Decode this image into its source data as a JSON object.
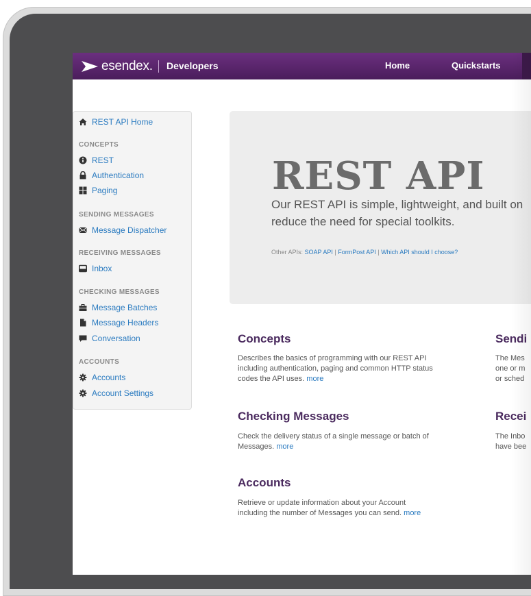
{
  "header": {
    "brand": "esendex",
    "brand_dot": ".",
    "section": "Developers",
    "nav": [
      {
        "label": "Home"
      },
      {
        "label": "Quickstarts"
      }
    ]
  },
  "sidebar": {
    "home": {
      "label": "REST API Home",
      "icon": "home-icon"
    },
    "groups": [
      {
        "heading": "CONCEPTS",
        "items": [
          {
            "label": "REST",
            "icon": "info-icon"
          },
          {
            "label": "Authentication",
            "icon": "lock-icon"
          },
          {
            "label": "Paging",
            "icon": "grid-icon"
          }
        ]
      },
      {
        "heading": "SENDING MESSAGES",
        "items": [
          {
            "label": "Message Dispatcher",
            "icon": "envelope-icon"
          }
        ]
      },
      {
        "heading": "RECEIVING MESSAGES",
        "items": [
          {
            "label": "Inbox",
            "icon": "inbox-icon"
          }
        ]
      },
      {
        "heading": "CHECKING MESSAGES",
        "items": [
          {
            "label": "Message Batches",
            "icon": "briefcase-icon"
          },
          {
            "label": "Message Headers",
            "icon": "file-icon"
          },
          {
            "label": "Conversation",
            "icon": "comment-icon"
          }
        ]
      },
      {
        "heading": "ACCOUNTS",
        "items": [
          {
            "label": "Accounts",
            "icon": "gear-icon"
          },
          {
            "label": "Account Settings",
            "icon": "gear-icon"
          }
        ]
      }
    ]
  },
  "hero": {
    "title": "REST API",
    "description_line1": "Our REST API is simple, lightweight, and built on",
    "description_line2": "reduce the need for special toolkits.",
    "other_label": "Other APIs:",
    "links": [
      "SOAP API",
      "FormPost API",
      "Which API should I choose?"
    ],
    "separator": "|"
  },
  "sections": {
    "concepts": {
      "title": "Concepts",
      "line1": "Describes the basics of programming with our REST API",
      "line2": "including authentication, paging and common HTTP status",
      "line3": "codes the API uses.",
      "more": "more"
    },
    "sending": {
      "title": "Sendi",
      "line1": "The Mes",
      "line2": "one or m",
      "line3": "or sched"
    },
    "checking": {
      "title": "Checking Messages",
      "line1": "Check the delivery status of a single message or batch of",
      "line2": "Messages.",
      "more": "more"
    },
    "receiving": {
      "title": "Recei",
      "line1": "The Inbo",
      "line2": "have bee"
    },
    "accounts": {
      "title": "Accounts",
      "line1": "Retrieve or update information about your Account",
      "line2": "including the number of Messages you can send.",
      "more": "more"
    }
  },
  "colors": {
    "header_purple": "#5a2570",
    "link_blue": "#2b7bc0",
    "section_title": "#4a2a5e",
    "bezel": "#4d4d4f"
  }
}
